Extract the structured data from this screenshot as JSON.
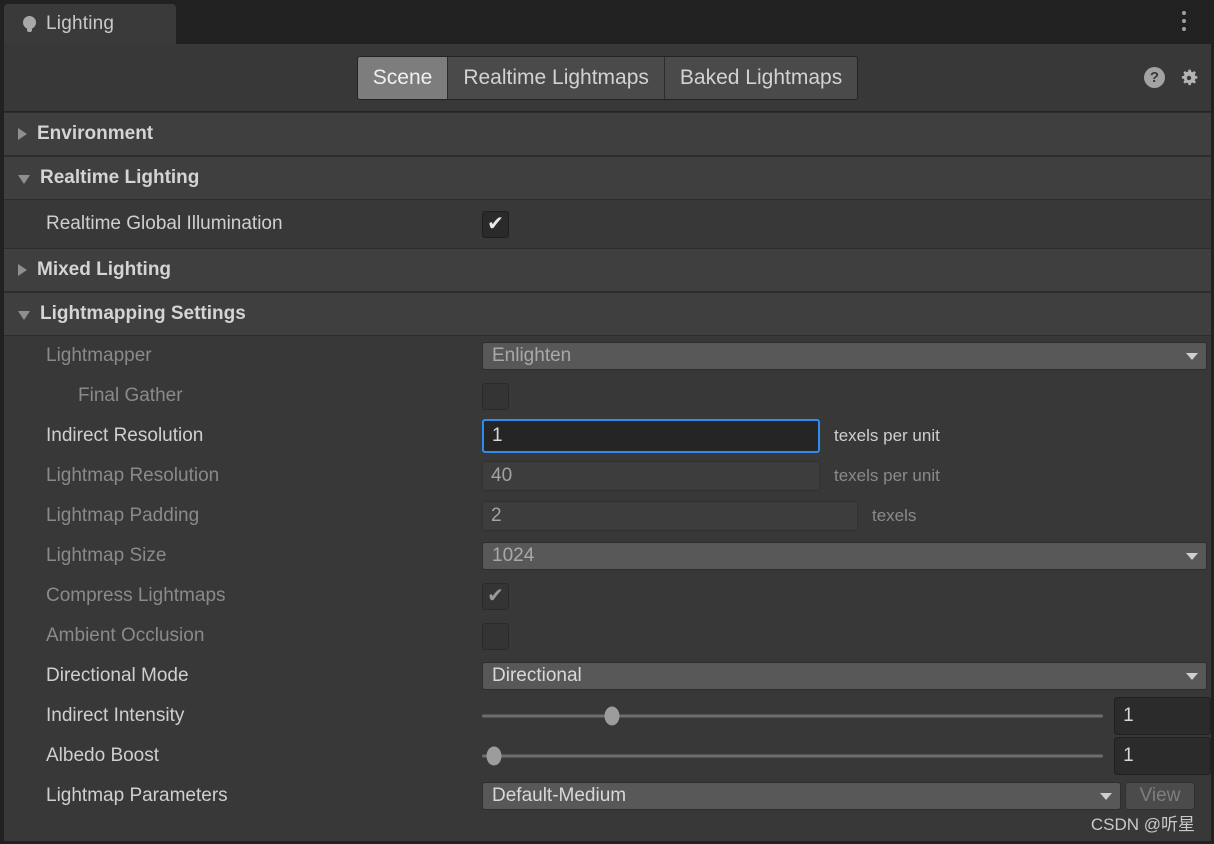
{
  "window": {
    "tab_label": "Lighting",
    "tab_icon": "lightbulb-icon",
    "kebab_icon": "more-options-icon"
  },
  "toolbar": {
    "tabs": [
      {
        "label": "Scene",
        "selected": true
      },
      {
        "label": "Realtime Lightmaps",
        "selected": false
      },
      {
        "label": "Baked Lightmaps",
        "selected": false
      }
    ],
    "help_icon": "help-icon",
    "help_glyph": "?",
    "settings_icon": "gear-icon"
  },
  "sections": [
    {
      "title": "Environment",
      "expanded": false
    },
    {
      "title": "Realtime Lighting",
      "expanded": true
    },
    {
      "title": "Mixed Lighting",
      "expanded": false
    },
    {
      "title": "Lightmapping Settings",
      "expanded": true
    }
  ],
  "realtime_lighting": {
    "realtime_gi": {
      "label": "Realtime Global Illumination",
      "checked": true,
      "check_glyph": "✔"
    }
  },
  "lightmapping": {
    "lightmapper": {
      "label": "Lightmapper",
      "value": "Enlighten",
      "disabled": true
    },
    "final_gather": {
      "label": "Final Gather",
      "checked": false,
      "disabled": true
    },
    "indirect_resolution": {
      "label": "Indirect Resolution",
      "value": "1",
      "suffix": "texels per unit",
      "focused": true,
      "disabled": false
    },
    "lightmap_resolution": {
      "label": "Lightmap Resolution",
      "value": "40",
      "suffix": "texels per unit",
      "disabled": true
    },
    "lightmap_padding": {
      "label": "Lightmap Padding",
      "value": "2",
      "suffix": "texels",
      "disabled": true
    },
    "lightmap_size": {
      "label": "Lightmap Size",
      "value": "1024",
      "disabled": true
    },
    "compress_lightmaps": {
      "label": "Compress Lightmaps",
      "checked": true,
      "check_glyph": "✔",
      "disabled": true
    },
    "ambient_occlusion": {
      "label": "Ambient Occlusion",
      "checked": false,
      "disabled": true
    },
    "directional_mode": {
      "label": "Directional Mode",
      "value": "Directional",
      "disabled": false
    },
    "indirect_intensity": {
      "label": "Indirect Intensity",
      "value": "1",
      "slider_percent": 21
    },
    "albedo_boost": {
      "label": "Albedo Boost",
      "value": "1",
      "slider_percent": 2
    },
    "lightmap_parameters": {
      "label": "Lightmap Parameters",
      "value": "Default-Medium",
      "view_label": "View"
    }
  },
  "colors": {
    "panel_bg": "#383838",
    "header_bg": "#3f3f3f",
    "chrome_bg": "#212121",
    "accent_focus": "#2c8cf0",
    "text": "#cfcfcf",
    "text_dim": "#8a8a8a",
    "tab_selected": "#7d7d7d"
  },
  "watermark": {
    "text": "CSDN @听星"
  }
}
